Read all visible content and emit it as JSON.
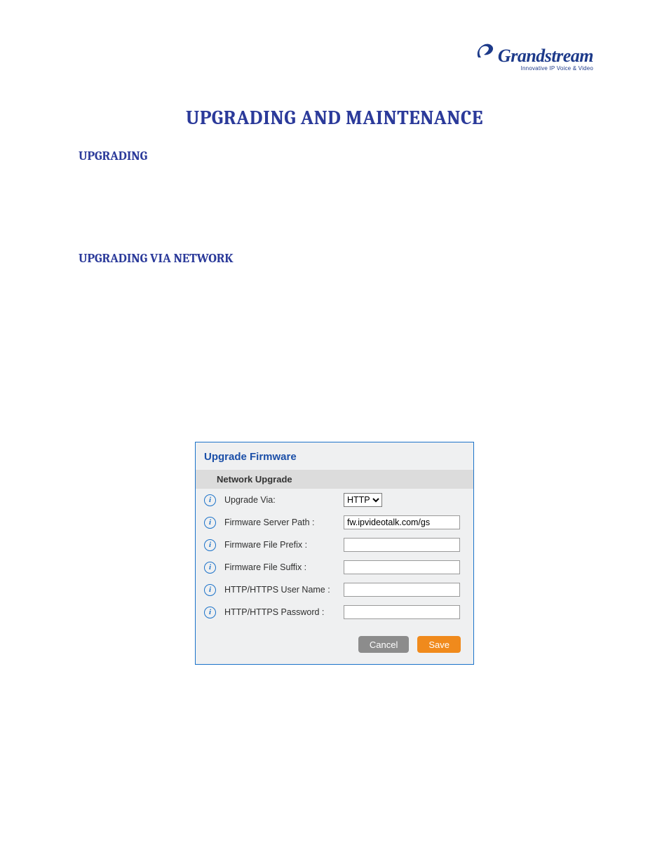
{
  "logo": {
    "brand": "Grandstream",
    "tagline": "Innovative IP Voice & Video"
  },
  "page_title": "UPGRADING AND MAINTENANCE",
  "h2a": "UPGRADING",
  "h2b": "UPGRADING VIA NETWORK",
  "panel": {
    "title": "Upgrade Firmware",
    "section": "Network Upgrade",
    "rows": {
      "upgrade_via": {
        "label": "Upgrade Via:",
        "value": "HTTP"
      },
      "server_path": {
        "label": "Firmware Server Path :",
        "value": "fw.ipvideotalk.com/gs"
      },
      "file_prefix": {
        "label": "Firmware File Prefix :",
        "value": ""
      },
      "file_suffix": {
        "label": "Firmware File Suffix :",
        "value": ""
      },
      "http_user": {
        "label": "HTTP/HTTPS User Name :",
        "value": ""
      },
      "http_pass": {
        "label": "HTTP/HTTPS Password :",
        "value": ""
      }
    },
    "buttons": {
      "cancel": "Cancel",
      "save": "Save"
    }
  }
}
